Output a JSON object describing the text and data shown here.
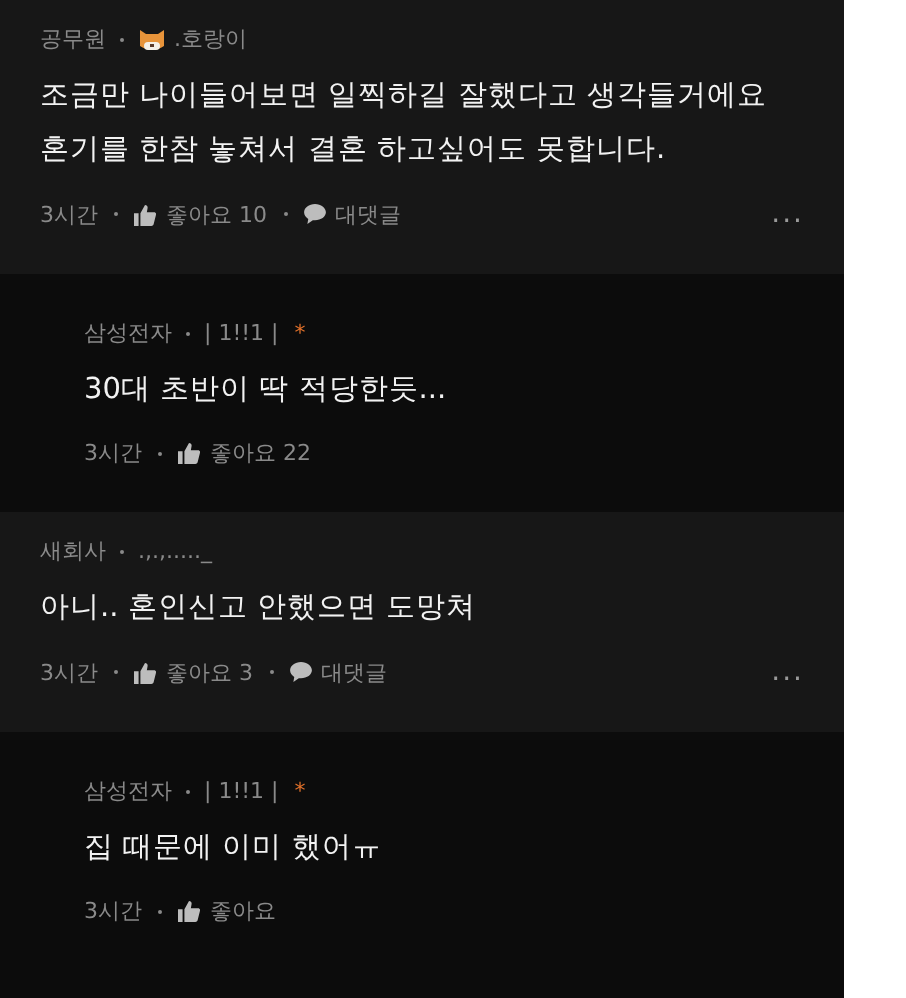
{
  "comments": [
    {
      "kind": "comment",
      "company": "공무원",
      "avatar": true,
      "nickname": ".호랑이",
      "body": [
        "조금만 나이들어보면 일찍하길 잘했다고 생각들거에요",
        "혼기를 한참 놓쳐서 결혼 하고싶어도 못합니다."
      ],
      "time": "3시간",
      "likes": "좋아요 10",
      "reply": "대댓글",
      "more": "..."
    },
    {
      "kind": "reply",
      "company": "삼성전자",
      "nickname": "| 1!!1 |",
      "mark": "*",
      "body": [
        "30대 초반이 딱 적당한듯..."
      ],
      "time": "3시간",
      "likes": "좋아요 22"
    },
    {
      "kind": "comment",
      "company": "새회사",
      "nickname": ".,.,....._",
      "body": [
        "아니.. 혼인신고 안했으면 도망쳐"
      ],
      "time": "3시간",
      "likes": "좋아요 3",
      "reply": "대댓글",
      "more": "..."
    },
    {
      "kind": "reply",
      "company": "삼성전자",
      "nickname": "| 1!!1 |",
      "mark": "*",
      "body": [
        "집 때문에 이미 했어ㅠ"
      ],
      "time": "3시간",
      "likes": "좋아요"
    }
  ]
}
